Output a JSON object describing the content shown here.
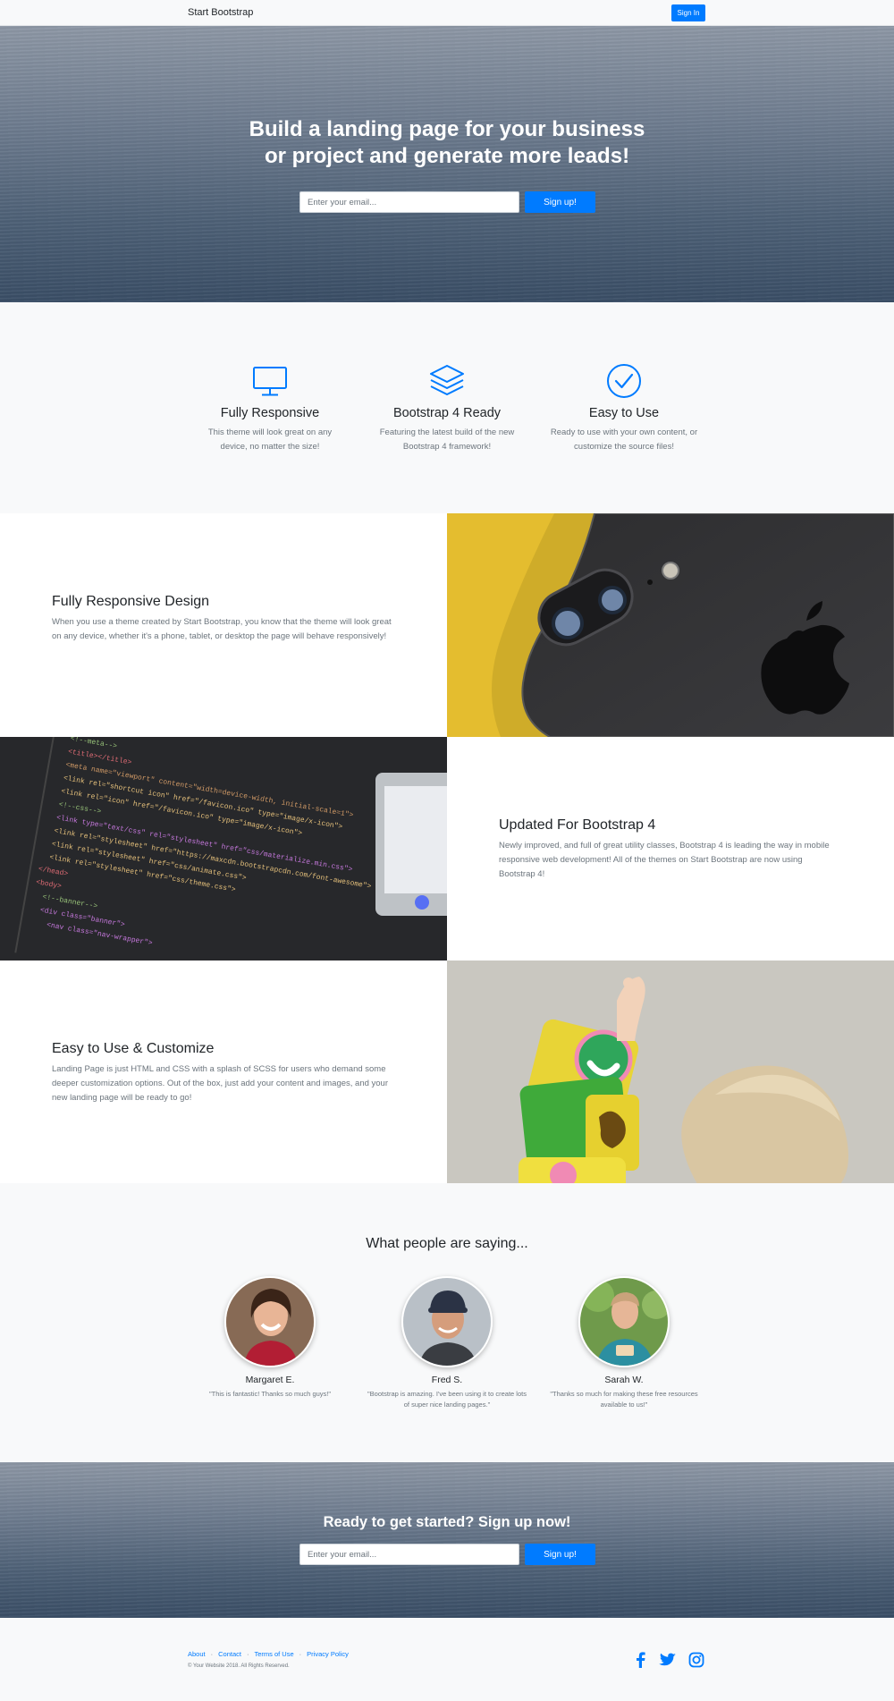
{
  "navbar": {
    "brand": "Start Bootstrap",
    "signin_label": "Sign In"
  },
  "masthead": {
    "headline_line1": "Build a landing page for your business",
    "headline_line2": "or project and generate more leads!",
    "email_placeholder": "Enter your email...",
    "signup_label": "Sign up!"
  },
  "features": [
    {
      "icon": "desktop-icon",
      "title": "Fully Responsive",
      "text": "This theme will look great on any device, no matter the size!"
    },
    {
      "icon": "layers-icon",
      "title": "Bootstrap 4 Ready",
      "text": "Featuring the latest build of the new Bootstrap 4 framework!"
    },
    {
      "icon": "check-circle-icon",
      "title": "Easy to Use",
      "text": "Ready to use with your own content, or customize the source files!"
    }
  ],
  "showcase": [
    {
      "title": "Fully Responsive Design",
      "text": "When you use a theme created by Start Bootstrap, you know that the theme will look great on any device, whether it's a phone, tablet, or desktop the page will behave responsively!"
    },
    {
      "title": "Updated For Bootstrap 4",
      "text": "Newly improved, and full of great utility classes, Bootstrap 4 is leading the way in mobile responsive web development! All of the themes on Start Bootstrap are now using Bootstrap 4!"
    },
    {
      "title": "Easy to Use & Customize",
      "text": "Landing Page is just HTML and CSS with a splash of SCSS for users who demand some deeper customization options. Out of the box, just add your content and images, and your new landing page will be ready to go!"
    }
  ],
  "testimonials": {
    "title": "What people are saying...",
    "items": [
      {
        "name": "Margaret E.",
        "quote": "\"This is fantastic! Thanks so much guys!\""
      },
      {
        "name": "Fred S.",
        "quote": "\"Bootstrap is amazing. I've been using it to create lots of super nice landing pages.\""
      },
      {
        "name": "Sarah W.",
        "quote": "\"Thanks so much for making these free resources available to us!\""
      }
    ]
  },
  "cta": {
    "title": "Ready to get started? Sign up now!",
    "email_placeholder": "Enter your email...",
    "signup_label": "Sign up!"
  },
  "footer": {
    "links": [
      "About",
      "Contact",
      "Terms of Use",
      "Privacy Policy"
    ],
    "separator": "·",
    "copyright": "© Your Website 2018. All Rights Reserved.",
    "social": [
      "facebook-icon",
      "twitter-icon",
      "instagram-icon"
    ]
  },
  "colors": {
    "primary": "#007bff",
    "text": "#212529",
    "muted": "#6c757d",
    "light": "#f8f9fa"
  }
}
